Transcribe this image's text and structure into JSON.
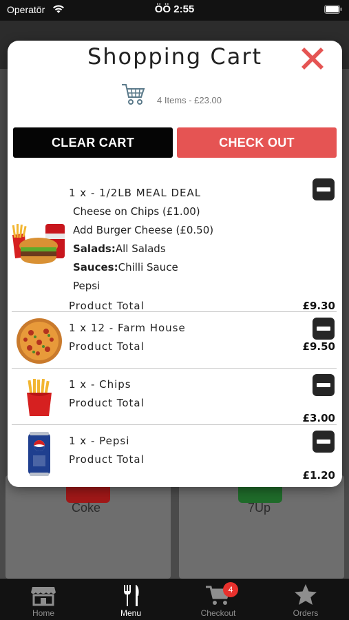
{
  "status_bar": {
    "carrier": "Operatör",
    "time": "ÖÖ 2:55"
  },
  "background": {
    "card_left_label": "Coke",
    "card_right_label": "7Up"
  },
  "tab_bar": {
    "tabs": [
      {
        "label": "Home",
        "icon": "store-icon"
      },
      {
        "label": "Menu",
        "icon": "fork-knife-icon",
        "active": true
      },
      {
        "label": "Checkout",
        "icon": "cart-icon",
        "badge": "4"
      },
      {
        "label": "Orders",
        "icon": "star-icon"
      }
    ]
  },
  "modal": {
    "title": "Shopping Cart",
    "summary": "4 Items - £23.00",
    "clear_label": "CLEAR CART",
    "checkout_label": "CHECK OUT",
    "accent": "#e55453",
    "items": [
      {
        "title": "1 x - 1/2LB MEAL DEAL",
        "lines": [
          {
            "plain": "Cheese on Chips (£1.00)"
          },
          {
            "plain": "Add Burger Cheese (£0.50)"
          },
          {
            "bold": "Salads:",
            "plain": "All Salads"
          },
          {
            "bold": "Sauces:",
            "plain": "Chilli Sauce"
          },
          {
            "plain": "Pepsi"
          }
        ],
        "total_label": "Product Total",
        "price": "£9.30",
        "image": "meal-deal-image"
      },
      {
        "title": "1 x 12 - Farm House",
        "total_label": "Product Total",
        "price": "£9.50",
        "image": "pizza-image"
      },
      {
        "title": "1 x - Chips",
        "total_label": "Product Total",
        "price": "£3.00",
        "image": "chips-image"
      },
      {
        "title": "1 x - Pepsi",
        "total_label": "Product Total",
        "price": "£1.20",
        "image": "pepsi-can-image"
      }
    ]
  }
}
